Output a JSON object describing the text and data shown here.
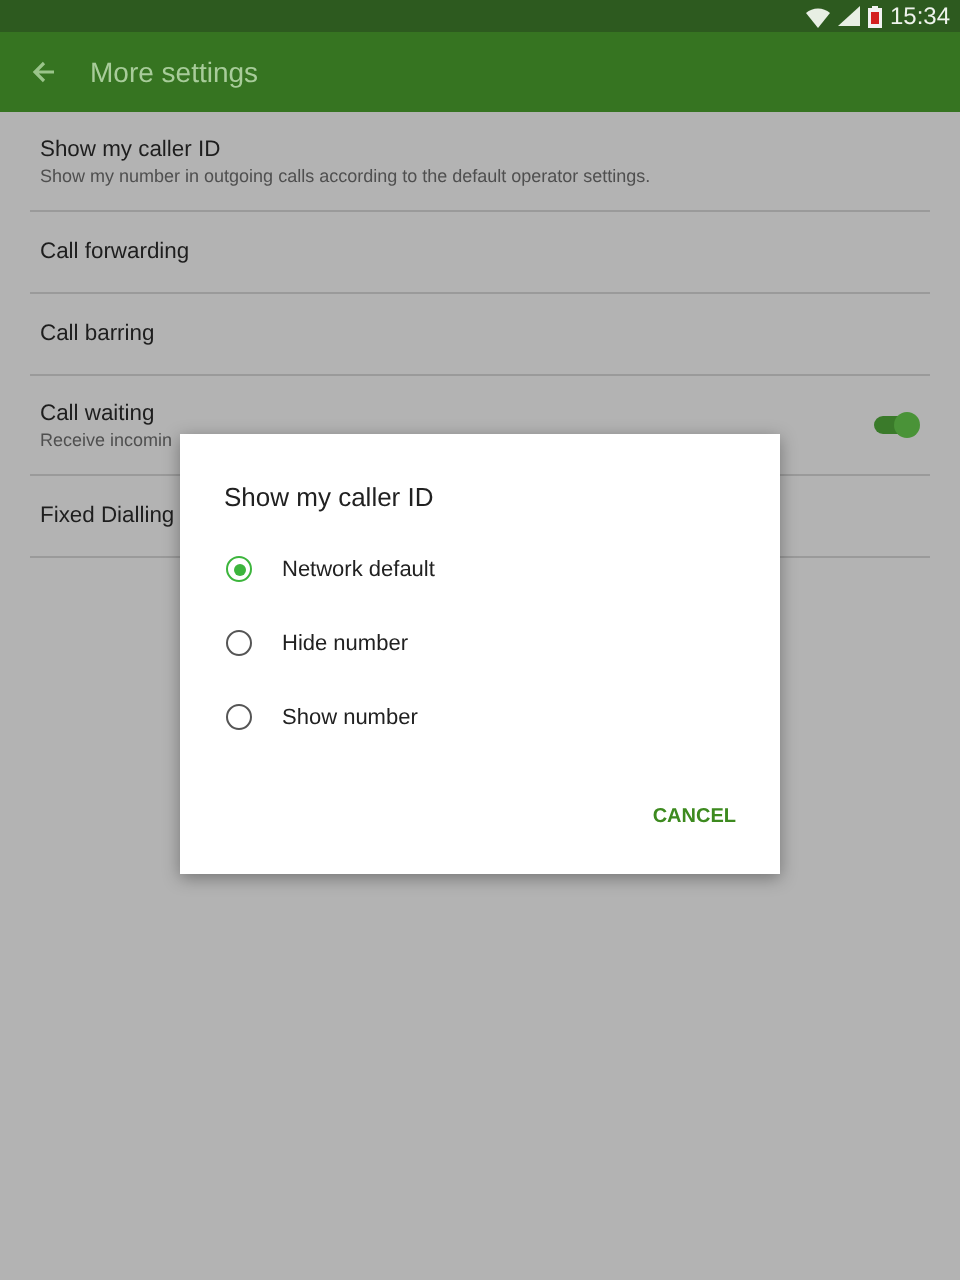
{
  "status_bar": {
    "time": "15:34"
  },
  "app_bar": {
    "title": "More settings"
  },
  "settings": [
    {
      "title": "Show my caller ID",
      "subtitle": "Show my number in outgoing calls according to the default operator settings.",
      "kind": "text"
    },
    {
      "title": "Call forwarding",
      "kind": "text"
    },
    {
      "title": "Call barring",
      "kind": "text"
    },
    {
      "title": "Call waiting",
      "subtitle": "Receive incomin",
      "kind": "switch",
      "on": true
    },
    {
      "title": "Fixed Dialling",
      "kind": "text"
    }
  ],
  "dialog": {
    "title": "Show my caller ID",
    "options": [
      {
        "label": "Network default",
        "selected": true
      },
      {
        "label": "Hide number",
        "selected": false
      },
      {
        "label": "Show number",
        "selected": false
      }
    ],
    "buttons": [
      "CANCEL"
    ]
  }
}
